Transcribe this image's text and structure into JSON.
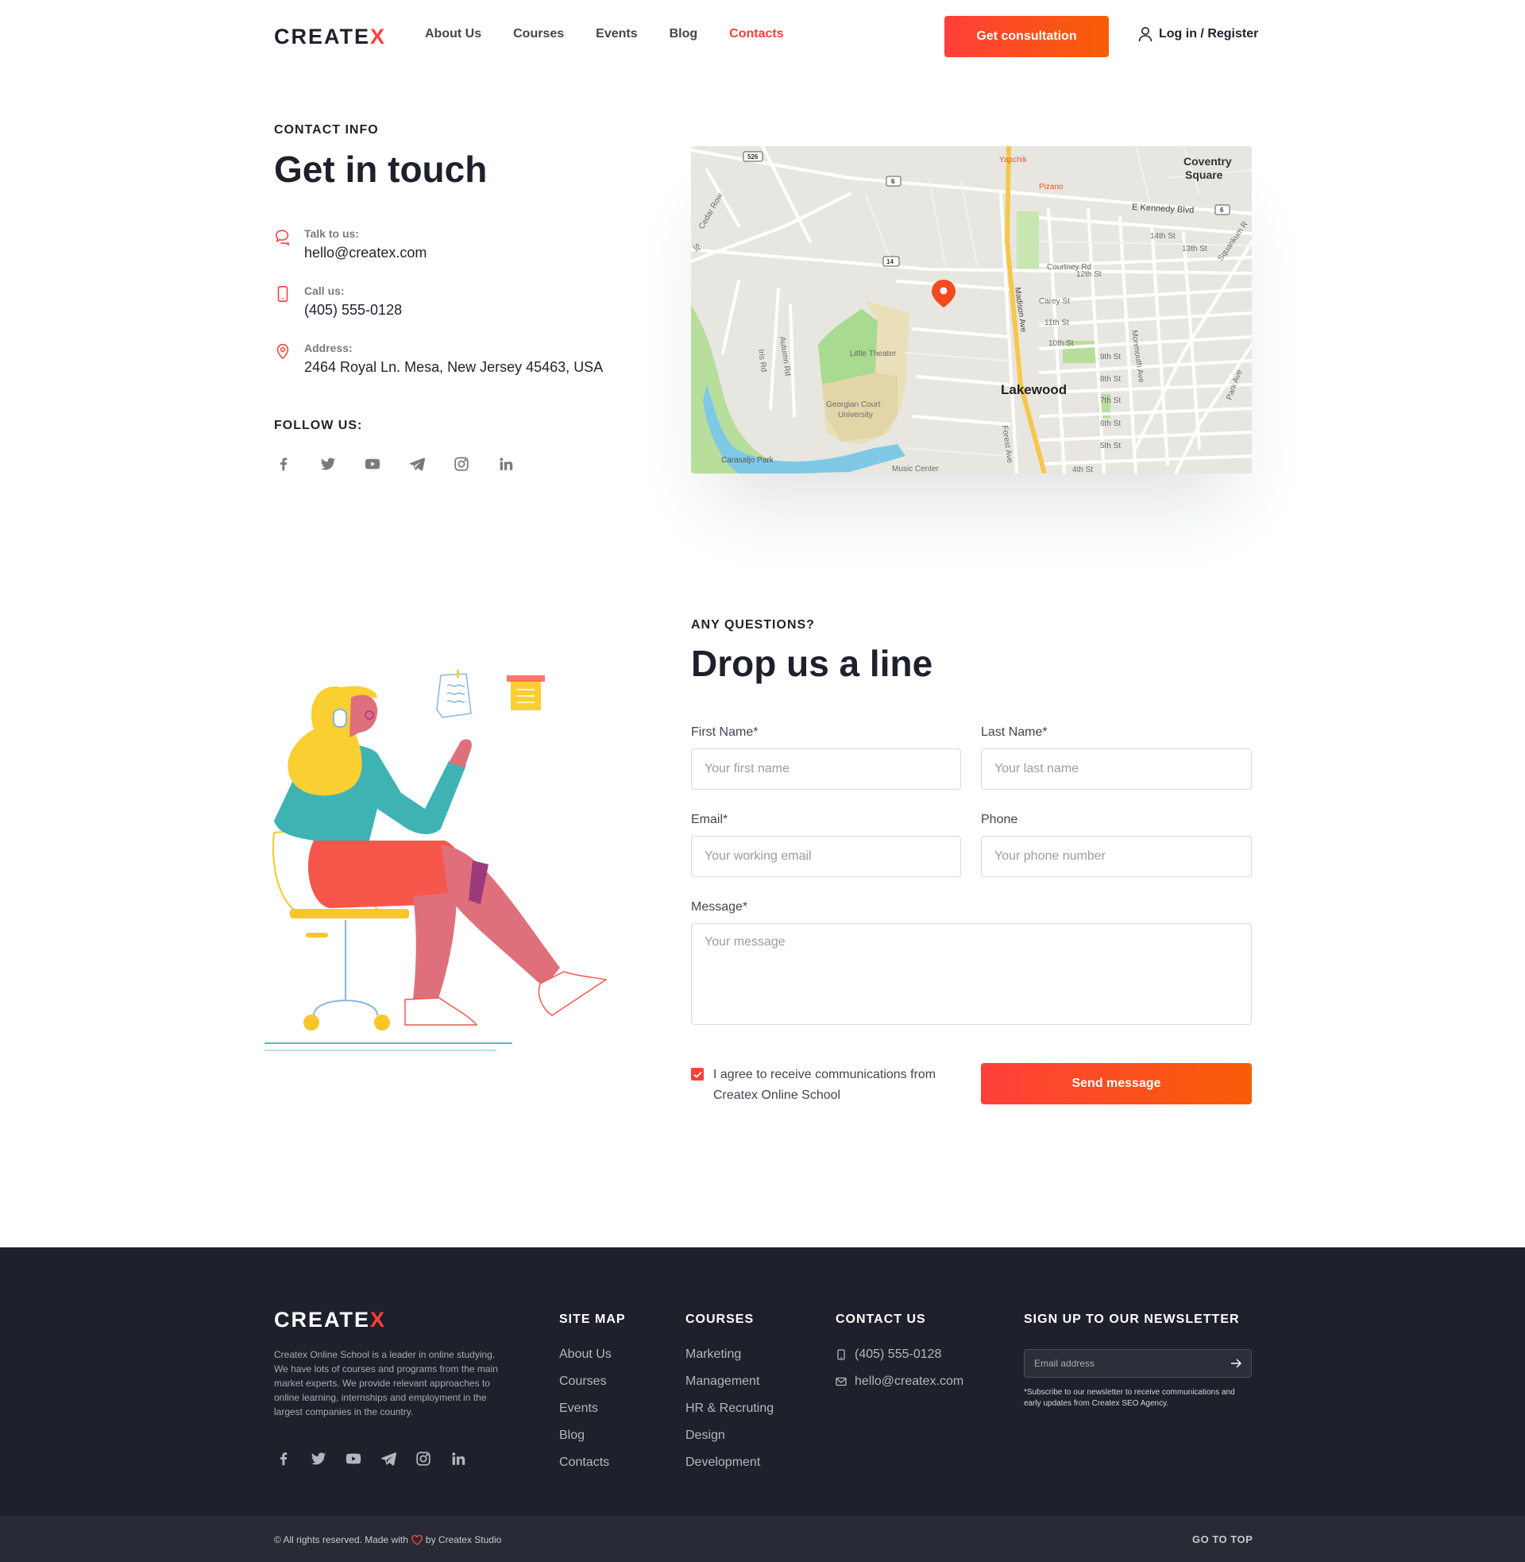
{
  "header": {
    "logo_main": "CREATE",
    "logo_x": "X",
    "nav": [
      {
        "label": "About Us"
      },
      {
        "label": "Courses"
      },
      {
        "label": "Events"
      },
      {
        "label": "Blog"
      },
      {
        "label": "Contacts"
      }
    ],
    "active_nav": "Contacts",
    "consult_button": "Get consultation",
    "login": "Log in / Register"
  },
  "contact_info": {
    "eyebrow": "CONTACT INFO",
    "title": "Get in touch",
    "items": [
      {
        "icon": "chat-icon",
        "label": "Talk to us:",
        "value": "hello@createx.com"
      },
      {
        "icon": "phone-icon",
        "label": "Call us:",
        "value": "(405) 555-0128"
      },
      {
        "icon": "location-pin-icon",
        "label": "Address:",
        "value": "2464 Royal Ln. Mesa, New Jersey 45463, USA"
      }
    ],
    "follow_label": "FOLLOW US:",
    "socials": [
      "facebook-icon",
      "twitter-icon",
      "youtube-icon",
      "telegram-icon",
      "instagram-icon",
      "linkedin-icon"
    ]
  },
  "map": {
    "labels": {
      "coventry": "Coventry",
      "square": "Square",
      "kennedy": "E Kennedy Blvd",
      "yapchik": "Yapchik",
      "pizano": "Pizano",
      "cedar": "Cedar Row",
      "st": "St",
      "st14": "14th St",
      "st13": "13th St",
      "squankum": "Squankum R",
      "courtney": "Courtney Rd",
      "st12": "12th St",
      "carey": "Carey St",
      "st11": "11th St",
      "st10": "10th St",
      "st9": "9th St",
      "st8": "8th St",
      "st7": "7th St",
      "st6": "6th St",
      "st5": "5th St",
      "st4": "4th St",
      "madison": "Madison Ave",
      "monmouth": "Monmouth Ave",
      "lakewood": "Lakewood",
      "little_theater": "Little Theater",
      "georgian1": "Georgian Court",
      "georgian2": "University",
      "autumn": "Autumn Rd",
      "iris": "Iris Rd",
      "carasaljo": "Carasaljo Park",
      "music": "Music Center",
      "forest": "Forest Ave",
      "park": "Park Ave",
      "r526": "526",
      "r6a": "6",
      "r6b": "6",
      "r14": "14"
    }
  },
  "form": {
    "eyebrow": "ANY QUESTIONS?",
    "title": "Drop us a line",
    "first_name": {
      "label": "First Name*",
      "placeholder": "Your first name"
    },
    "last_name": {
      "label": "Last  Name*",
      "placeholder": "Your last name"
    },
    "email": {
      "label": "Email*",
      "placeholder": "Your working email"
    },
    "phone": {
      "label": "Phone",
      "placeholder": "Your phone number"
    },
    "message": {
      "label": "Message*",
      "placeholder": "Your message"
    },
    "agree_text": "I agree to receive communications from Createx Online School",
    "agree_checked": true,
    "submit": "Send message"
  },
  "footer": {
    "logo_main": "CREATE",
    "logo_x": "X",
    "description": "Createx Online School is a leader in online studying. We have lots of courses and programs from the main market experts. We provide relevant approaches to online learning, internships and employment in the largest companies in the country.",
    "site_map": {
      "title": "SITE MAP",
      "links": [
        "About Us",
        "Courses",
        "Events",
        "Blog",
        "Contacts"
      ]
    },
    "courses": {
      "title": "COURSES",
      "links": [
        "Marketing",
        "Management",
        "HR & Recruting",
        "Design",
        "Development"
      ]
    },
    "contact": {
      "title": "CONTACT US",
      "phone": "(405) 555-0128",
      "email": "hello@createx.com"
    },
    "newsletter": {
      "title": "SIGN UP TO OUR NEWSLETTER",
      "placeholder": "Email address",
      "note": "*Subscribe to our newsletter to receive communications and early updates from Createx SEO Agency."
    },
    "copyright_pre": "© All rights reserved. Made with",
    "copyright_post": "by Createx Studio",
    "go_top": "GO TO TOP"
  },
  "colors": {
    "accent": "#ff3f3a",
    "dark": "#1e212c",
    "gray": "#787a80"
  }
}
